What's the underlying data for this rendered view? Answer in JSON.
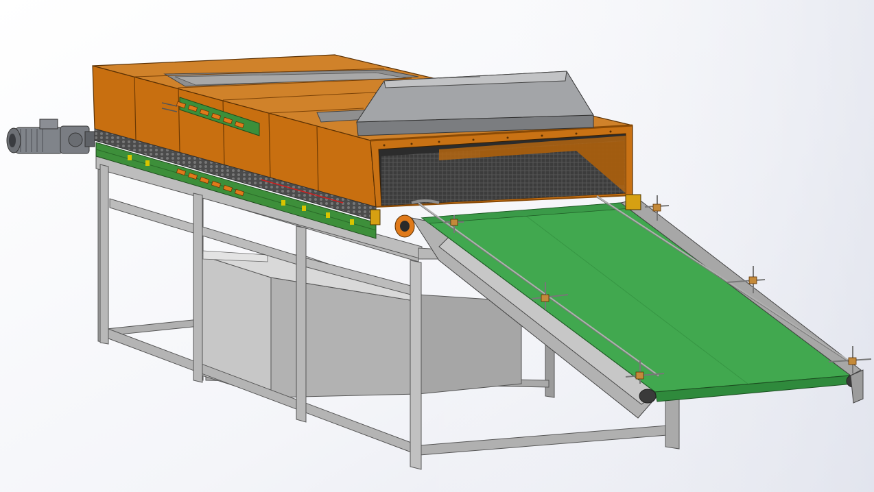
{
  "scene": {
    "description_visible_text": "",
    "colors": {
      "background_top": "#e9ebf2",
      "background_bottom": "#ffffff",
      "oven_orange": "#c8720f",
      "oven_orange_dark": "#8a4a05",
      "oven_orange_light": "#e08a24",
      "frame_steel": "#a9a9a9",
      "frame_steel_dark": "#6c6c6c",
      "hood_gray": "#9fa1a3",
      "belt_green": "#3fa64f",
      "belt_green_dark": "#2b7d39",
      "guide_green": "#3c8f3a",
      "motor_gray": "#7d8086",
      "tank_gray": "#b9b9b9"
    },
    "components": [
      {
        "name": "electric-motor-gearbox",
        "icon": "motor-icon"
      },
      {
        "name": "oven-tunnel-housing",
        "icon": "box-icon"
      },
      {
        "name": "exhaust-hood",
        "icon": "hood-icon"
      },
      {
        "name": "drive-chain-rail",
        "icon": "chain-icon"
      },
      {
        "name": "steel-support-frame",
        "icon": "frame-icon"
      },
      {
        "name": "collection-tank",
        "icon": "tank-icon"
      },
      {
        "name": "inclined-green-conveyor",
        "icon": "conveyor-icon"
      },
      {
        "name": "tension-adjuster-handles",
        "icon": "handle-icon"
      }
    ]
  }
}
